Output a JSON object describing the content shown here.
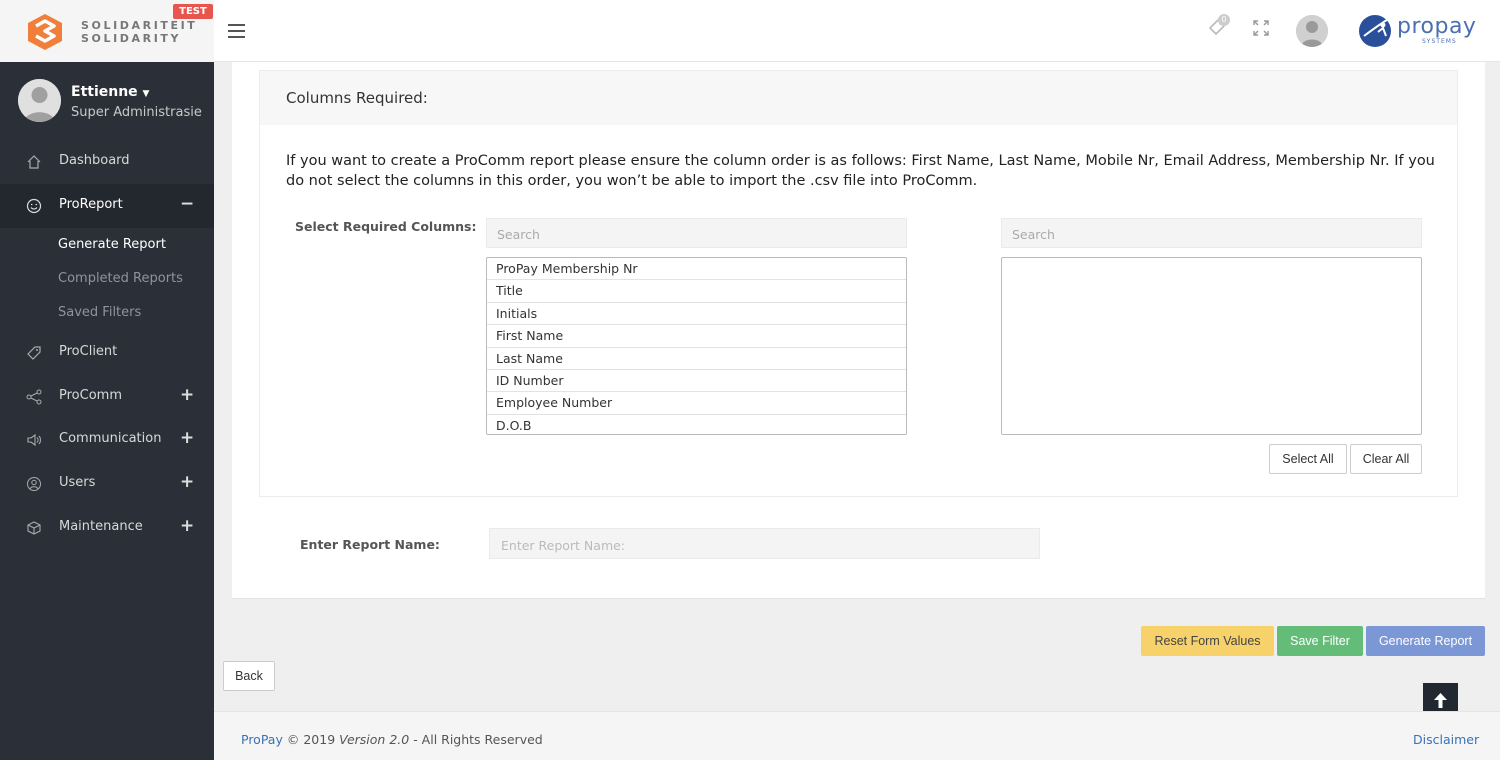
{
  "brand": {
    "line1": "SOLIDARITEIT",
    "line2": "SOLIDARITY",
    "badge": "TEST",
    "brand_color": "#f07f3c"
  },
  "header": {
    "notification_count": "0",
    "propay_word": "propay",
    "propay_sub": "SYSTEMS",
    "propay_color": "#2a4f9b"
  },
  "user": {
    "name": "Ettienne",
    "role": "Super Administrasie"
  },
  "sidebar": {
    "items": [
      {
        "label": "Dashboard",
        "icon": "home-icon"
      },
      {
        "label": "ProReport",
        "icon": "smile-icon",
        "expanded": true
      },
      {
        "label": "ProClient",
        "icon": "tag-icon"
      },
      {
        "label": "ProComm",
        "icon": "share-icon"
      },
      {
        "label": "Communication",
        "icon": "speaker-icon"
      },
      {
        "label": "Users",
        "icon": "user-circle-icon"
      },
      {
        "label": "Maintenance",
        "icon": "package-icon"
      }
    ],
    "subitems": [
      {
        "label": "Generate Report",
        "current": true
      },
      {
        "label": "Completed Reports"
      },
      {
        "label": "Saved Filters"
      }
    ]
  },
  "main": {
    "card_title": "Columns Required:",
    "notice": "If you want to create a ProComm report please ensure the column order is as follows: First Name, Last Name, Mobile Nr, Email Address, Membership Nr. If you do not select the columns in this order, you won’t be able to import the .csv file into ProComm.",
    "select_label": "Select Required Columns:",
    "left_search_placeholder": "Search",
    "right_search_placeholder": "Search",
    "available_columns": [
      "ProPay Membership Nr",
      "Title",
      "Initials",
      "First Name",
      "Last Name",
      "ID Number",
      "Employee Number",
      "D.O.B"
    ],
    "select_all_label": "Select All",
    "clear_all_label": "Clear All",
    "report_name_label": "Enter Report Name:",
    "report_name_placeholder": "Enter Report Name:"
  },
  "actions": {
    "reset_label": "Reset Form Values",
    "save_label": "Save Filter",
    "generate_label": "Generate Report",
    "back_label": "Back"
  },
  "footer": {
    "brand_link": "ProPay",
    "copyright": "© 2019",
    "version": "Version 2.0",
    "rights": "- All Rights Reserved",
    "disclaimer": "Disclaimer"
  }
}
